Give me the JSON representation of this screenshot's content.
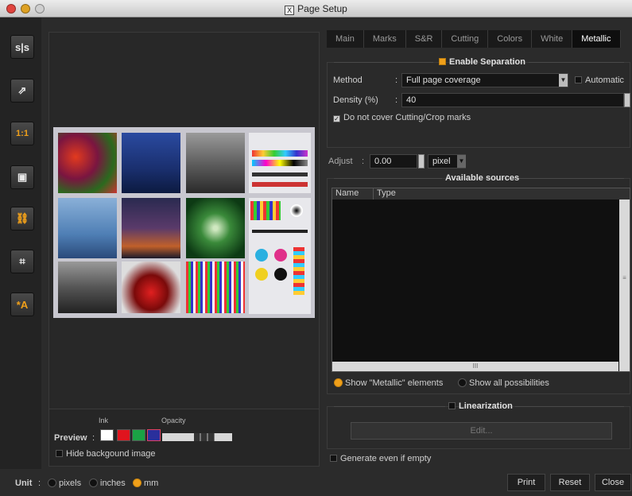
{
  "window": {
    "title": "Page Setup",
    "title_icon": "X"
  },
  "toolbar": {
    "tools": [
      {
        "name": "mirror-tool",
        "glyph": "s|s"
      },
      {
        "name": "export-tool",
        "glyph": "⇗"
      },
      {
        "name": "actual-size-tool",
        "glyph": "1:1"
      },
      {
        "name": "fit-page-tool",
        "glyph": "▣"
      },
      {
        "name": "link-tool",
        "glyph": "⛓"
      },
      {
        "name": "fit-selection-tool",
        "glyph": "⌗"
      },
      {
        "name": "auto-text-tool",
        "glyph": "*A"
      }
    ]
  },
  "preview": {
    "ink_label": "Ink",
    "opacity_label": "Opacity",
    "preview_label": "Preview",
    "hide_bg_label": "Hide backgound image",
    "swatches": [
      "#ffffff",
      "#e0141e",
      "#1aa345",
      "#2a2f9c"
    ]
  },
  "unit": {
    "label": "Unit",
    "options": [
      "pixels",
      "inches",
      "mm"
    ],
    "selected": "mm"
  },
  "tabs": [
    "Main",
    "Marks",
    "S&R",
    "Cutting",
    "Colors",
    "White",
    "Metallic"
  ],
  "active_tab": "Metallic",
  "separation": {
    "enable_label": "Enable Separation",
    "method_label": "Method",
    "method_value": "Full page coverage",
    "automatic_label": "Automatic",
    "density_label": "Density (%)",
    "density_value": "40",
    "no_cover_label": "Do not cover Cutting/Crop marks"
  },
  "adjust": {
    "label": "Adjust",
    "value": "0.00",
    "unit": "pixel"
  },
  "sources": {
    "title": "Available sources",
    "columns": [
      "Name",
      "Type"
    ],
    "scroll_glyph": "III",
    "show_metallic_label": "Show \"Metallic\" elements",
    "show_all_label": "Show all possibilities"
  },
  "linearization": {
    "label": "Linearization",
    "edit_label": "Edit..."
  },
  "generate_label": "Generate even if empty",
  "buttons": {
    "print": "Print",
    "reset": "Reset",
    "close": "Close"
  },
  "colors": {
    "accent": "#f0a01a",
    "bg": "#2b2b2b"
  }
}
